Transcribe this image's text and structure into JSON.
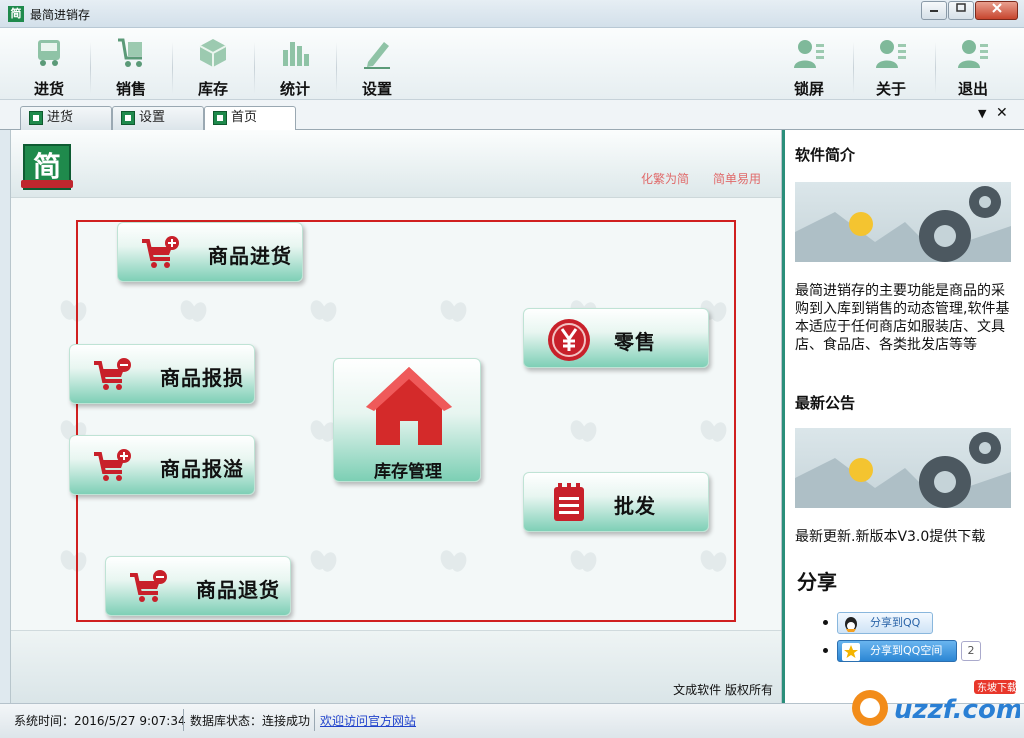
{
  "window": {
    "title": "最简进销存",
    "icon_glyph": "简",
    "controls": {
      "minimize": "▭",
      "maximize": "◻",
      "close": "✕"
    }
  },
  "toolbar": {
    "items": [
      {
        "label": "进货",
        "icon": "truck-icon"
      },
      {
        "label": "销售",
        "icon": "cart-icon"
      },
      {
        "label": "库存",
        "icon": "box-icon"
      },
      {
        "label": "统计",
        "icon": "bar-chart-icon"
      },
      {
        "label": "设置",
        "icon": "pencil-icon"
      },
      {
        "label": "锁屏",
        "icon": "user-icon"
      },
      {
        "label": "关于",
        "icon": "user-icon"
      },
      {
        "label": "退出",
        "icon": "user-icon"
      }
    ]
  },
  "tabs": {
    "items": [
      {
        "label": "进货",
        "active": false
      },
      {
        "label": "设置",
        "active": false
      },
      {
        "label": "首页",
        "active": true
      }
    ],
    "dropdown_glyph": "▼",
    "close_glyph": "✕"
  },
  "home": {
    "logo_glyph": "简",
    "slogans": [
      "化繁为简",
      "简单易用"
    ],
    "buttons": {
      "purchase": "商品进货",
      "loss": "商品报损",
      "overflow": "商品报溢",
      "return": "商品退货",
      "retail": "零售",
      "wholesale": "批发",
      "inventory": "库存管理"
    },
    "copyright": "文成软件  版权所有"
  },
  "sidebar": {
    "intro_title": "软件简介",
    "intro_text": "最简进销存的主要功能是商品的采购到入库到销售的动态管理,软件基本适应于任何商店如服装店、文具店、食品店、各类批发店等等",
    "notice_title": "最新公告",
    "notice_text": "最新更新.新版本V3.0提供下载",
    "share_title": "分享",
    "share_qq": "分享到QQ",
    "share_qzone": "分享到QQ空间",
    "share_count": "2"
  },
  "status": {
    "time": "系统时间：2016/5/27 9:07:34",
    "db": "数据库状态：连接成功",
    "link": "欢迎访问官方网站"
  },
  "watermark": {
    "text": "uzzf.com",
    "sub": "东坡下载"
  },
  "colors": {
    "brand_green": "#1f8a4c",
    "accent_red": "#c8202a",
    "teal": "#2a8e7a"
  }
}
